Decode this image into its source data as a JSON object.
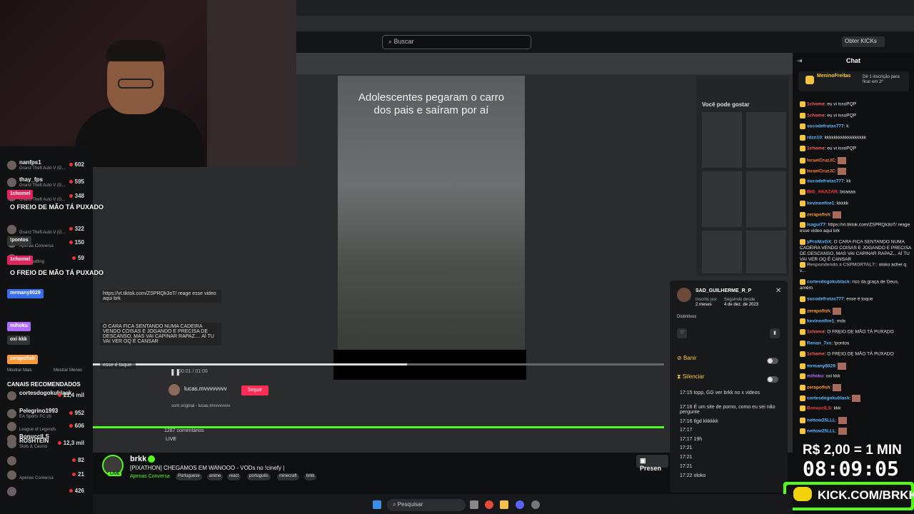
{
  "kick_header": {
    "search_placeholder": "Buscar",
    "get_kicks": "Obter KICKs"
  },
  "webcam": {
    "description_hidden": true
  },
  "video": {
    "caption": "Adolescentes pegaram o carro dos pais e saíram por aí",
    "time": "00:01 / 01:06",
    "progress": 0.55
  },
  "inner_sidebar": {
    "title": "Você pode gostar"
  },
  "leftnav": {
    "channels": [
      {
        "name": "nanfps1",
        "game": "Grand Theft Auto V (G...",
        "viewers": "602"
      },
      {
        "name": "thay_fps",
        "game": "Grand Theft Auto V (G...",
        "viewers": "595"
      },
      {
        "name": "",
        "game": "Grand Theft Auto V (G...",
        "viewers": "348"
      },
      {
        "name": "",
        "game": "Grand Theft Auto V (G...",
        "viewers": "322"
      },
      {
        "name": "",
        "game": "Apenas Conversa",
        "viewers": "150"
      },
      {
        "name": "",
        "game": "Just Chatting",
        "viewers": "59"
      }
    ],
    "overlay_msgs": [
      "O FREIO DE MÃO TÁ PUXADO",
      "O FREIO DE MÃO TÁ PUXADO",
      "oxi kkk",
      "1chomel",
      "!pontos",
      "mrmany8029",
      "mihoku",
      "zerapofish",
      "Mostrar Mais",
      "Mostrar Menos",
      "1chomel"
    ],
    "recommended_title": "CANAIS RECOMENDADOS",
    "recommended": [
      {
        "name": "cortesdogokublack",
        "game": "",
        "viewers": "21,4 mil"
      },
      {
        "name": "Pelegrino1993",
        "game": "EA Sports FC 26",
        "viewers": "952"
      },
      {
        "name": "",
        "game": "League of Legends",
        "viewers": "606"
      },
      {
        "name": "BonuccILS",
        "game": "",
        "viewers": ""
      },
      {
        "name": "ROSHTEIN",
        "game": "Slots & Casino",
        "viewers": "12,3 mil"
      },
      {
        "name": "",
        "game": "",
        "viewers": "82"
      },
      {
        "name": "",
        "game": "Apenas Conversa",
        "viewers": "21"
      },
      {
        "name": "",
        "game": "",
        "viewers": "426"
      }
    ]
  },
  "stage_overlay": {
    "line1": "https://vt.tiktok.com/ZSPRQk3oT/ reage esse video aqui brk",
    "line2": "O CARA FICA SENTANDO NUMA CADEIRA VENDO COISAS E JOGANDO E PRECISA DE DESCANSO, MAS VAI CAPINAR RAPAZ.... AÍ TU VAI VER OQ É CANSAR",
    "line3": "esse é toque",
    "follow_label": "Seguir",
    "author": "lucas.mvvvvvvvv",
    "sound": "som original - lucas.mvvvvvvvv",
    "comments": "1287 comentários",
    "live": "LIVE"
  },
  "stream": {
    "channel": "brkk",
    "live": "LIVE",
    "title": "[PIXATHON] CHEGAMOS EM WANOOO - VODs no !cinefy |",
    "category": "Apenas Conversa",
    "tags": [
      "Portuguese",
      "anime",
      "react",
      "português",
      "minecraft",
      "brkk"
    ],
    "present": "Presen"
  },
  "popup": {
    "username": "SAD_GUILHERME_R_P",
    "subscribed_label": "Inscrito por",
    "subscribed_value": "2 meses",
    "following_label": "Seguindo desde",
    "following_value": "4 de dez. de 2023",
    "badges_label": "Distintivos",
    "ban": "Banir",
    "mute": "Silenciar",
    "history": [
      "17:15 topp, GG ver brkk no x videos",
      "17:16 É um site de porno, como eu sei não pergunte",
      "17:16 tlgd kkkkkk",
      "17:17",
      "17:17 19h",
      "17:21",
      "17:21",
      "17:21",
      "17:22 oloko"
    ]
  },
  "chat": {
    "title": "Chat",
    "pinned_user": "MeninoFreitas",
    "pinned_text": "Dê 1 inscrição para ficar em 2º",
    "messages": [
      {
        "user": "1chome",
        "color": "#ff5b5b",
        "text": "eu vi issoPQP"
      },
      {
        "user": "1chome",
        "color": "#ff5b5b",
        "text": "eu vi issoPQP"
      },
      {
        "user": "sucodefrutas777",
        "color": "#5bb8ff",
        "text": "k"
      },
      {
        "user": "rdzn10",
        "color": "#5bb8ff",
        "text": "kkkkkkkkkkkkkkkkkk"
      },
      {
        "user": "1chome",
        "color": "#ff5b5b",
        "text": "eu vi issoPQP"
      },
      {
        "user": "IsraelCruzJC",
        "color": "#ff7a3d",
        "text": ""
      },
      {
        "user": "IsraelCruzJC",
        "color": "#ff7a3d",
        "text": ""
      },
      {
        "user": "sucodefrutas777",
        "color": "#5bb8ff",
        "text": "kk"
      },
      {
        "user": "BIG_AKAZAR",
        "color": "#ff3b3b",
        "text": "boaaaa"
      },
      {
        "user": "kevinonfire1",
        "color": "#5bb8ff",
        "text": "kkkkk"
      },
      {
        "user": "zerapofish",
        "color": "#ff9a3d",
        "text": ""
      },
      {
        "user": "Isagui77",
        "color": "#5bb8ff",
        "text": "https://vt.tiktok.com/ZSPRQk3oT/ reage esse video aqui brk"
      },
      {
        "user": "yProNixGX",
        "color": "#5bb8ff",
        "text": "O CARA FICA SENTANDO NUMA CADEIRA VENDO COISAS E JOGANDO E PRECISA DE DESCANSO, MAS VAI CAPINAR RAPAZ... AÍ TU VAI VER OQ É CANSAR"
      },
      {
        "user": "Respondendo a CSPMORTAL7:",
        "color": "#999999",
        "text": "oloko achei q v..."
      },
      {
        "user": "cortesdogokublack",
        "color": "#5bb8ff",
        "text": "rico da graça de Deus, amém"
      },
      {
        "user": "sucodefrutas777",
        "color": "#5bb8ff",
        "text": "esse é toque"
      },
      {
        "user": "zerapofish",
        "color": "#ff9a3d",
        "text": ""
      },
      {
        "user": "kevinonfire1",
        "color": "#5bb8ff",
        "text": "mds"
      },
      {
        "user": "1chome",
        "color": "#ff5b5b",
        "text": "O FREIO DE MÃO TÁ PUXADO"
      },
      {
        "user": "Renan_7xs",
        "color": "#5bb8ff",
        "text": "!pontos"
      },
      {
        "user": "1chome",
        "color": "#ff5b5b",
        "text": "O FREIO DE MÃO TÁ PUXADO"
      },
      {
        "user": "mrmany8029",
        "color": "#5bb8ff",
        "text": ""
      },
      {
        "user": "mihoku",
        "color": "#b06bff",
        "text": "oxi kkk"
      },
      {
        "user": "zerapofish",
        "color": "#ff9a3d",
        "text": ""
      },
      {
        "user": "cortesdogokublack",
        "color": "#5bb8ff",
        "text": ""
      },
      {
        "user": "BonuccILS",
        "color": "#ff3b3b",
        "text": "kkk"
      },
      {
        "user": "nettow25LLL",
        "color": "#5bb8ff",
        "text": ""
      },
      {
        "user": "nettow25LLL",
        "color": "#5bb8ff",
        "text": ""
      }
    ]
  },
  "overlays": {
    "price": "R$ 2,00 = 1 MIN",
    "clock": "08:09:05",
    "kick_url": "KICK.COM/BRKK"
  },
  "taskbar": {
    "search": "Pesquisar"
  },
  "colors": {
    "kick_green": "#53fc18",
    "bg": "#0e0f10"
  }
}
